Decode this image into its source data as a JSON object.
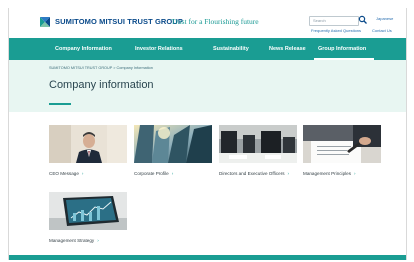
{
  "header": {
    "logo_text": "SUMITOMO MITSUI TRUST GROUP",
    "tagline": "Trust for a Flourishing future",
    "search_placeholder": "Search",
    "lang_link": "Japanese",
    "faq_link": "Frequently Asked Questions",
    "contact_link": "Contact Us",
    "icons": {
      "logo": "smtg-logo-icon",
      "search": "search-icon"
    }
  },
  "nav": {
    "items": [
      {
        "label": "Company Information"
      },
      {
        "label": "Investor Relations"
      },
      {
        "label": "Sustainability"
      },
      {
        "label": "News Release"
      },
      {
        "label": "Group Information"
      }
    ]
  },
  "breadcrumb": "SUMITOMO MITSUI TRUST GROUP > Company Information",
  "page_title": "Company information",
  "cards": [
    {
      "label": "CEO Message"
    },
    {
      "label": "Corporate Profile"
    },
    {
      "label": "Directors and Executive Officers"
    },
    {
      "label": "Management Principles"
    },
    {
      "label": "Management Strategy"
    }
  ],
  "colors": {
    "brand_teal": "#1a9d93",
    "banner_bg": "#e8f6f2",
    "logo_blue": "#0a4a8a"
  }
}
